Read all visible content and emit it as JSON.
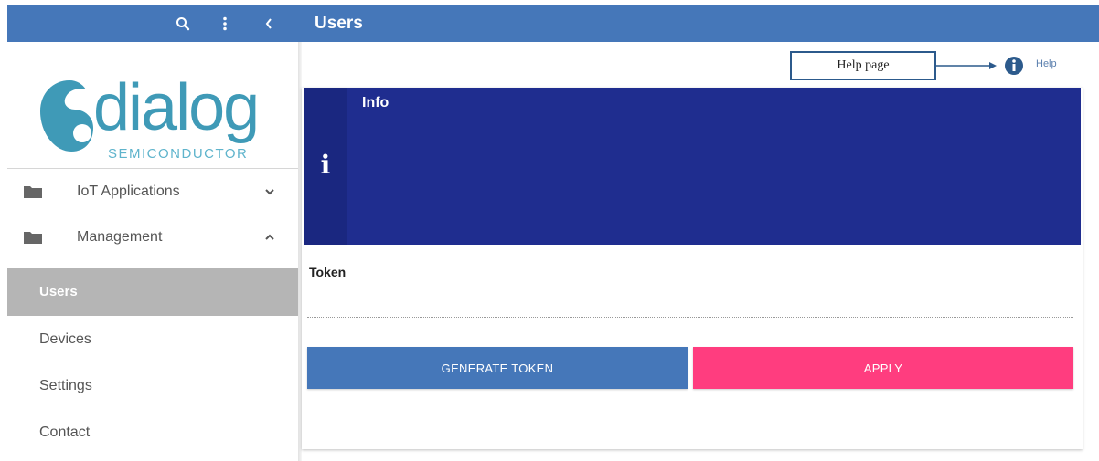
{
  "topbar": {
    "title": "Users",
    "icons": [
      "search-icon",
      "more-vert-icon",
      "chevron-left-icon"
    ]
  },
  "sidebar": {
    "logo": {
      "word": "dialog",
      "sub": "SEMICONDUCTOR"
    },
    "groups": [
      {
        "label": "IoT Applications",
        "icon": "folder-icon",
        "expanded": false
      },
      {
        "label": "Management",
        "icon": "folder-icon",
        "expanded": true
      }
    ],
    "items": [
      {
        "label": "Users",
        "active": true
      },
      {
        "label": "Devices",
        "active": false
      },
      {
        "label": "Settings",
        "active": false
      },
      {
        "label": "Contact",
        "active": false
      }
    ]
  },
  "annotation": {
    "help_page": "Help page"
  },
  "help": {
    "label": "Help",
    "icon": "info-icon"
  },
  "info": {
    "title": "Info",
    "icon_glyph": "i"
  },
  "token": {
    "label": "Token",
    "value": ""
  },
  "buttons": {
    "generate": "GENERATE TOKEN",
    "apply": "APPLY"
  },
  "colors": {
    "topbar": "#4577b9",
    "info_panel": "#1f2d8f",
    "apply": "#ff3d7f",
    "active_item": "#b5b5b5",
    "logo": "#3f9ab7"
  }
}
